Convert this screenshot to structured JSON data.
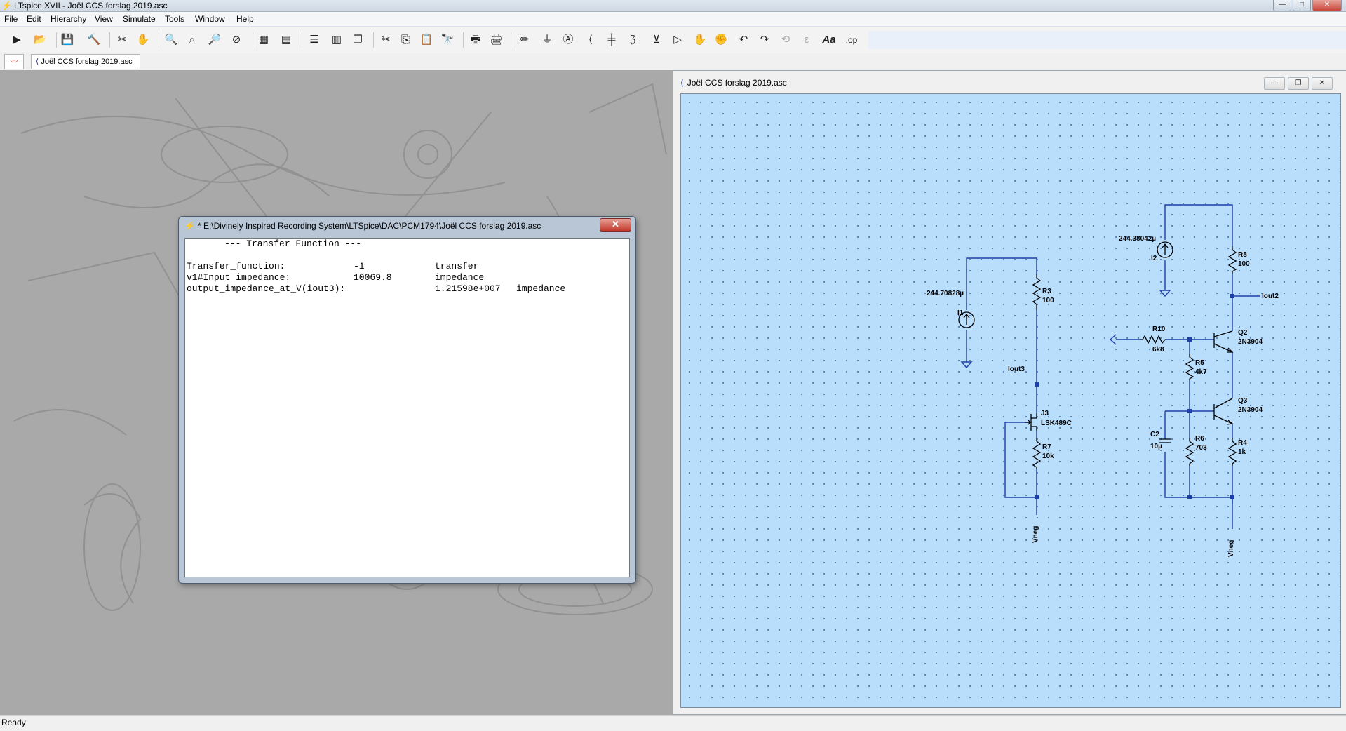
{
  "app": {
    "window_title": "LTspice XVII - Joël CCS forslag 2019.asc",
    "window_controls": {
      "minimize": "—",
      "maximize": "□",
      "close": "✕"
    }
  },
  "menu": [
    "File",
    "Edit",
    "Hierarchy",
    "View",
    "Simulate",
    "Tools",
    "Window",
    "Help"
  ],
  "toolbar": {
    "icons": [
      "run-icon",
      "open-icon",
      "save-icon",
      "control-panel-icon",
      "halt-icon",
      "pan-icon",
      "zoom-in-icon",
      "zoom-box-icon",
      "zoom-out-icon",
      "zoom-cancel-icon",
      "autorange-icon",
      "grid-icon",
      "tile-horizontal-icon",
      "tile-vertical-icon",
      "cascade-icon",
      "cut-icon",
      "copy-icon",
      "paste-icon",
      "find-icon",
      "print-icon",
      "print-setup-icon",
      "wire-icon",
      "ground-icon",
      "label-net-icon",
      "resistor-icon",
      "capacitor-icon",
      "inductor-icon",
      "diode-icon",
      "component-icon",
      "move-icon",
      "drag-icon",
      "undo-icon",
      "redo-icon",
      "rotate-icon",
      "mirror-icon",
      "text-icon",
      "spice-directive-icon"
    ]
  },
  "tabs": [
    {
      "label": ""
    },
    {
      "label": "Joël CCS forslag 2019.asc"
    }
  ],
  "dialog": {
    "title": "* E:\\Divinely Inspired Recording System\\LTSpice\\DAC\\PCM1794\\Joël CCS forslag 2019.asc",
    "close_label": "✕",
    "heading": "--- Transfer Function ---",
    "rows": [
      {
        "name": "Transfer_function:",
        "value": "-1",
        "unit": "transfer"
      },
      {
        "name": "v1#Input_impedance:",
        "value": "10069.8",
        "unit": "impedance"
      },
      {
        "name": "output_impedance_at_V(iout3):",
        "value": "1.21598e+007",
        "unit": "impedance"
      }
    ]
  },
  "schematic": {
    "title": "Joël CCS forslag 2019.asc",
    "labels": {
      "I1_value": "244.70828µ",
      "I1_name": "I1",
      "R3_name": "R3",
      "R3_value": "100",
      "iout3": "Iout3",
      "J3_name": "J3",
      "J3_model": "LSK489C",
      "R7_name": "R7",
      "R7_value": "10k",
      "vneg1": "Vneg",
      "I2_value": "244.38042µ",
      "I2_name": "I2",
      "R8_name": "R8",
      "R8_value": "100",
      "iout2": "Iout2",
      "R10_name": "R10",
      "R10_value": "6k8",
      "Q2_name": "Q2",
      "Q2_model": "2N3904",
      "R5_name": "R5",
      "R5_value": "4k7",
      "Q3_name": "Q3",
      "Q3_model": "2N3904",
      "C2_name": "C2",
      "C2_value": "10µ",
      "R6_name": "R6",
      "R6_value": "703",
      "R4_name": "R4",
      "R4_value": "1k",
      "vneg2": "Vneg"
    },
    "colors": {
      "canvas": "#b9defc",
      "wire": "#1d3fa8",
      "component": "#000000"
    }
  },
  "status": "Ready"
}
